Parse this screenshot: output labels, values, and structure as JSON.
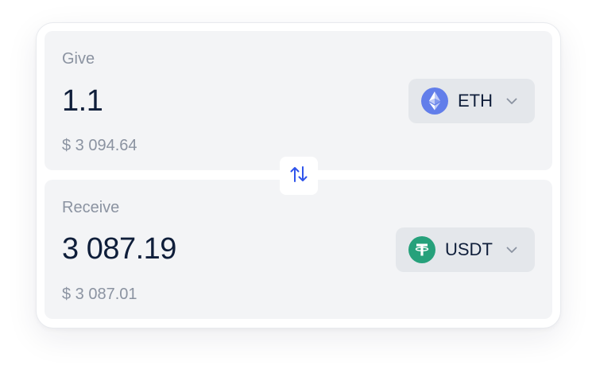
{
  "give": {
    "label": "Give",
    "amount": "1.1",
    "fiat": "$ 3 094.64",
    "token": {
      "symbol": "ETH",
      "icon": "ethereum-icon",
      "color": "#627eea"
    }
  },
  "receive": {
    "label": "Receive",
    "amount": "3 087.19",
    "fiat": "$ 3 087.01",
    "token": {
      "symbol": "USDT",
      "icon": "tether-icon",
      "color": "#26a17b"
    }
  },
  "swap": {
    "icon": "swap-arrows-icon",
    "color": "#2f54eb"
  }
}
